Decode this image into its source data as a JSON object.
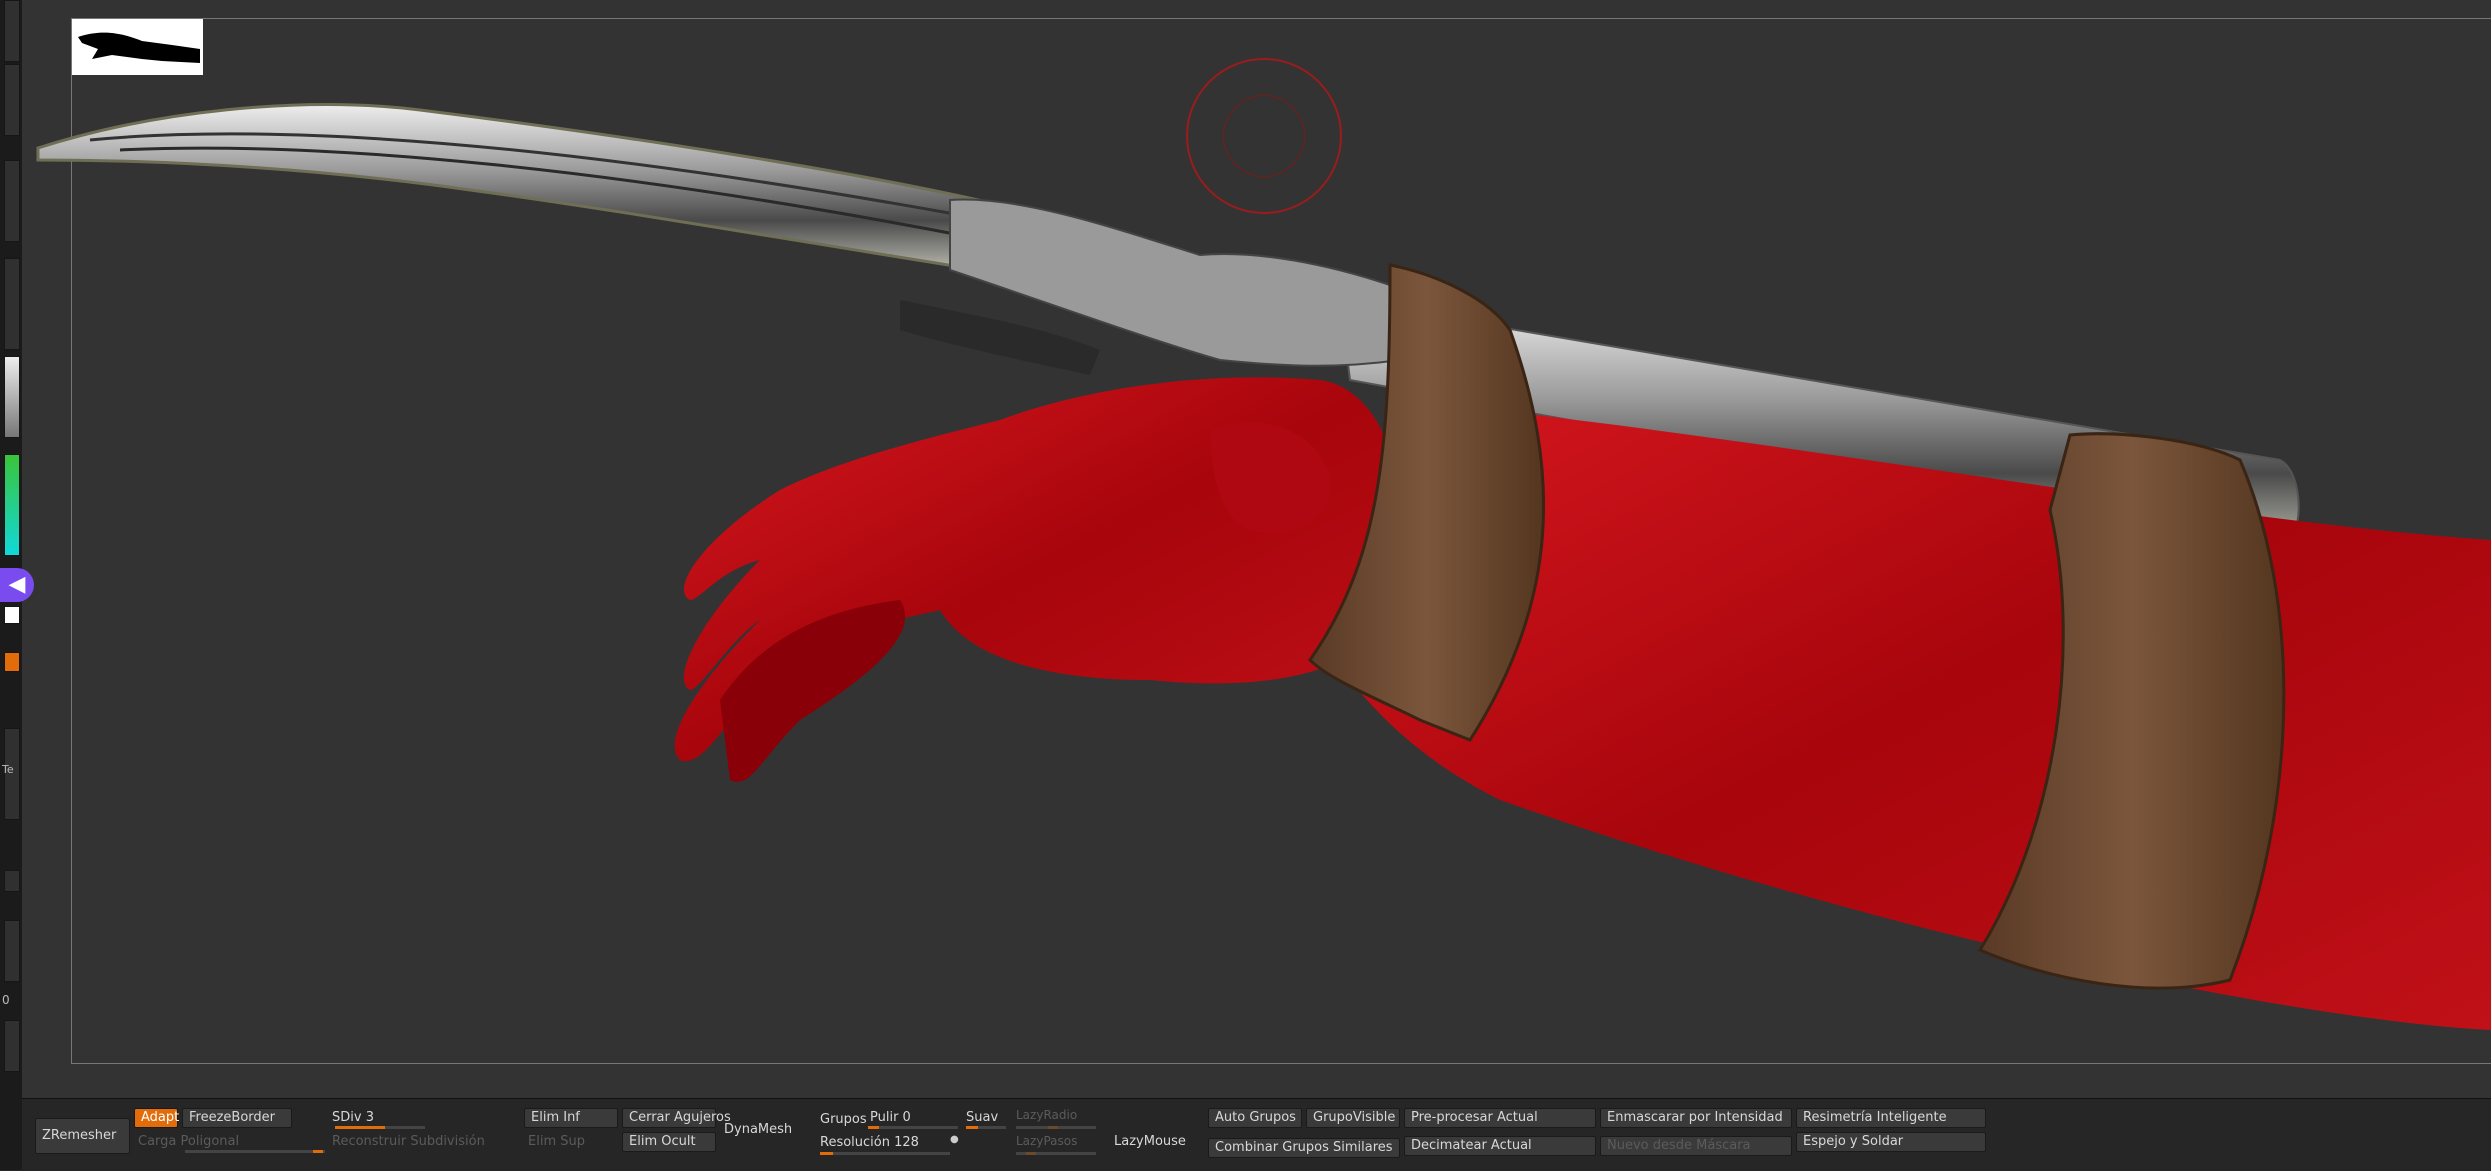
{
  "left_tray": {
    "number": "0",
    "label": "Te"
  },
  "nav": {
    "collapse_glyph": "◀"
  },
  "zremesher": {
    "title": "ZRemesher",
    "adapt": "Adapt",
    "freeze_border": "FreezeBorder",
    "carga_poligonal": "Carga Poligonal",
    "sdiv": "SDiv 3",
    "reconstruir": "Reconstruir Subdivisión",
    "elim_inf": "Elim Inf",
    "elim_sup": "Elim Sup",
    "cerrar_agujeros": "Cerrar Agujeros",
    "elim_oculto": "Elim Ocult",
    "dynamesh": "DynaMesh",
    "grupos": "Grupos",
    "pulir": "Pulir 0",
    "suav": "Suav",
    "resolucion": "Resolución 128",
    "lazy_radio": "LazyRadio",
    "lazy_pasos": "LazyPasos",
    "lazymouse": "LazyMouse",
    "auto_grupos": "Auto Grupos",
    "grupo_visible": "GrupoVisible",
    "combinar": "Combinar Grupos Similares",
    "preprocesar": "Pre-procesar Actual",
    "decimatear": "Decimatear Actual",
    "enmascarar": "Enmascarar por Intensidad",
    "nuevo_mascara": "Nuevo desde Máscara",
    "resimetria": "Resimetría Inteligente",
    "espejo": "Espejo y Soldar"
  },
  "progress": {
    "sdiv_fill": 0.55,
    "pulir_fill": 0.12,
    "resolucion_fill": 0.1
  },
  "colors": {
    "accent": "#e36c0a",
    "brush": "#9b1c1c",
    "nav": "#7a4cf0"
  }
}
